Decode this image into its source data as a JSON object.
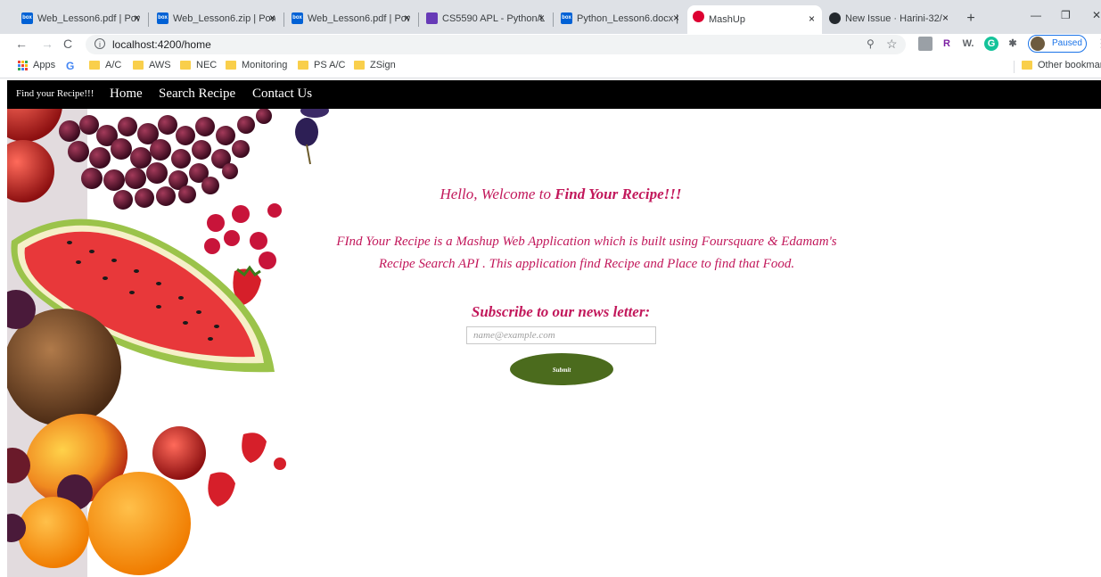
{
  "browser": {
    "tabs": [
      {
        "title": "Web_Lesson6.pdf | Pow",
        "favicon": "box-icon"
      },
      {
        "title": "Web_Lesson6.zip | Pow",
        "favicon": "box-icon"
      },
      {
        "title": "Web_Lesson6.pdf | Pow",
        "favicon": "box-icon"
      },
      {
        "title": "CS5590 APL - Python/L",
        "favicon": "class-icon"
      },
      {
        "title": "Python_Lesson6.docx |",
        "favicon": "box-icon"
      },
      {
        "title": "MashUp",
        "favicon": "angular-icon",
        "active": true
      },
      {
        "title": "New Issue · Harini-32/",
        "favicon": "github-icon"
      }
    ],
    "tab_close_glyph": "×",
    "box_favicon_text": "box",
    "new_tab_glyph": "+",
    "window_controls": {
      "minimize": "—",
      "restore": "❐",
      "close": "✕"
    },
    "nav": {
      "back": "←",
      "forward": "→",
      "reload": "C"
    },
    "address": {
      "info_glyph": "i",
      "url": "localhost:4200/home"
    },
    "profile_status": "Paused",
    "extensions": [
      "puzzle-icon",
      "R",
      "W.",
      "grammarly-icon",
      "extensions-icon"
    ],
    "bookmarks": {
      "apps": "Apps",
      "google": "G",
      "folders": [
        "A/C",
        "AWS",
        "NEC",
        "Monitoring",
        "PS A/C",
        "ZSign"
      ],
      "other": "Other bookmarks"
    }
  },
  "app": {
    "brand": "Find your Recipe!!!",
    "nav_links": [
      "Home",
      "Search Recipe",
      "Contact Us"
    ],
    "welcome_prefix": "Hello, Welcome to ",
    "welcome_brand": "Find Your Recipe!!!",
    "description_line1": "FInd Your Recipe is a Mashup Web Application which is built using Foursquare & Edamam's",
    "description_line2": "Recipe Search API . This application find Recipe and Place to find that Food.",
    "subscribe_heading": "Subscribe to our news letter:",
    "email_placeholder": "name@example.com",
    "submit_label": "Submit"
  },
  "colors": {
    "accent_text": "#c2185b",
    "submit_bg": "#4b6b1d",
    "navbar_bg": "#000000"
  }
}
